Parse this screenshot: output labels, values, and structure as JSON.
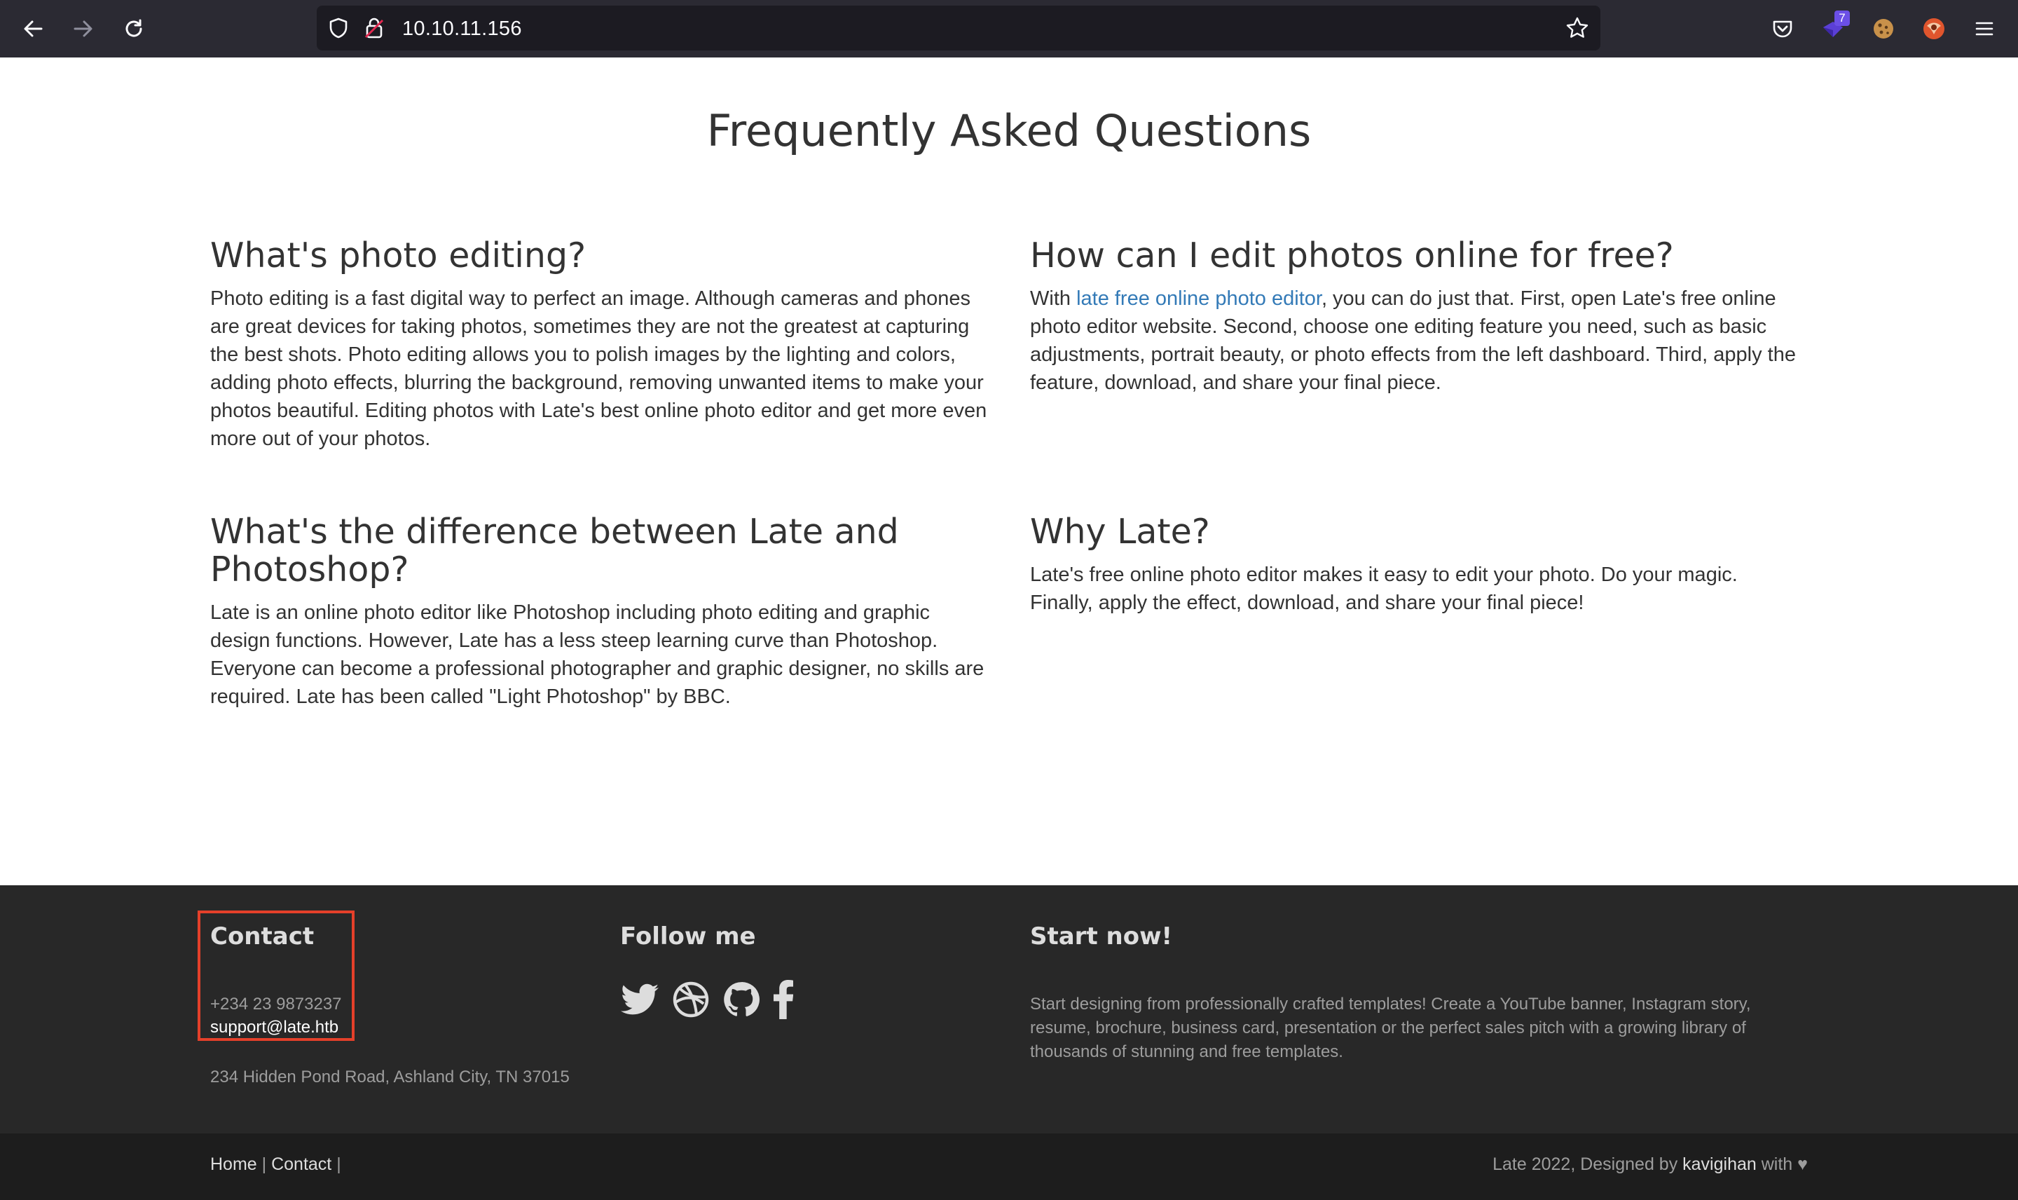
{
  "browser": {
    "url": "10.10.11.156",
    "extension_badge": "7",
    "icons": {
      "back": "back-arrow-icon",
      "forward": "forward-arrow-icon",
      "reload": "reload-icon",
      "shield": "tracking-shield-icon",
      "lock": "insecure-lock-icon",
      "bookmark": "bookmark-star-icon",
      "pocket": "pocket-icon",
      "menu": "hamburger-menu-icon"
    }
  },
  "page": {
    "title": "Frequently Asked Questions"
  },
  "faq": [
    {
      "question": "What's photo editing?",
      "answer": "Photo editing is a fast digital way to perfect an image. Although cameras and phones are great devices for taking photos, sometimes they are not the greatest at capturing the best shots. Photo editing allows you to polish images by the lighting and colors, adding photo effects, blurring the background, removing unwanted items to make your photos beautiful. Editing photos with Late's best online photo editor and get more even more out of your photos."
    },
    {
      "question": "How can I edit photos online for free?",
      "answer_prefix": "With ",
      "answer_link": "late free online photo editor",
      "answer_suffix": ", you can do just that. First, open Late's free online photo editor website. Second, choose one editing feature you need, such as basic adjustments, portrait beauty, or photo effects from the left dashboard. Third, apply the feature, download, and share your final piece."
    },
    {
      "question": "What's the difference between Late and Photoshop?",
      "answer": "Late is an online photo editor like Photoshop including photo editing and graphic design functions. However, Late has a less steep learning curve than Photoshop. Everyone can become a professional photographer and graphic designer, no skills are required. Late has been called \"Light Photoshop\" by BBC."
    },
    {
      "question": "Why Late?",
      "answer": "Late's free online photo editor makes it easy to edit your photo. Do your magic. Finally, apply the effect, download, and share your final piece!"
    }
  ],
  "footer": {
    "contact": {
      "heading": "Contact",
      "phone": "+234 23 9873237",
      "email": "support@late.htb",
      "address": "234 Hidden Pond Road, Ashland City, TN 37015"
    },
    "follow": {
      "heading": "Follow me",
      "icons": [
        "twitter-icon",
        "dribbble-icon",
        "github-icon",
        "facebook-icon"
      ]
    },
    "start": {
      "heading": "Start now!",
      "text": "Start designing from professionally crafted templates! Create a YouTube banner, Instagram story, resume, brochure, business card, presentation or the perfect sales pitch with a growing library of thousands of stunning and free templates."
    },
    "highlight_color": "#e5402a"
  },
  "bottom": {
    "home_link": "Home",
    "sep1": " | ",
    "contact_link": "Contact",
    "sep2": " |",
    "credit_prefix": "Late 2022, Designed by ",
    "credit_author": "kavigihan",
    "credit_suffix": " with ♥"
  }
}
